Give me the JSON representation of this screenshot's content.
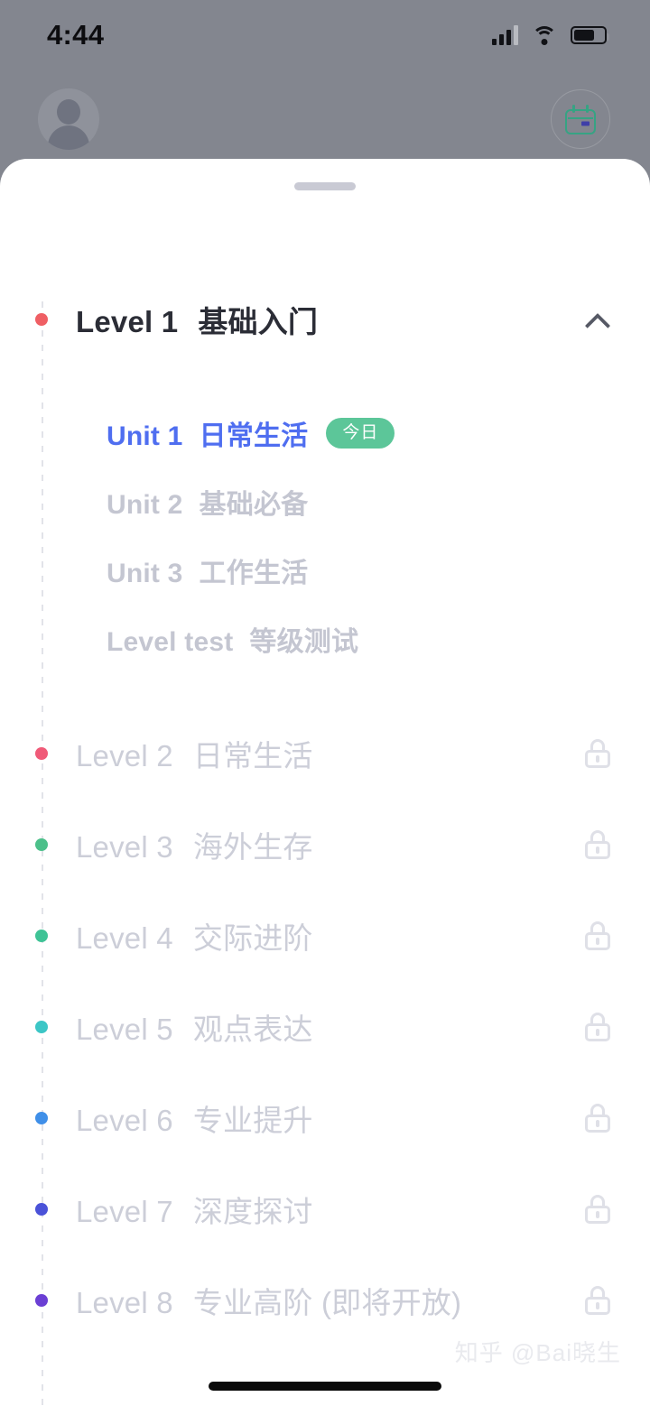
{
  "status_bar": {
    "time": "4:44",
    "signal_icon": "cellular-signal-icon",
    "wifi_icon": "wifi-icon",
    "battery_icon": "battery-icon",
    "battery_percent": 60
  },
  "backdrop_header": {
    "avatar_icon": "avatar-placeholder-icon",
    "calendar_icon": "calendar-icon",
    "calendar_accent": "#36a383"
  },
  "sheet": {
    "handle_icon": "drag-handle"
  },
  "course": {
    "expanded_level": {
      "name": "Level 1",
      "title": "基础入门",
      "dot_color": "#ef5f64",
      "collapse_icon": "chevron-up-icon",
      "units": [
        {
          "name": "Unit 1",
          "title": "日常生活",
          "badge": "今日",
          "active": true
        },
        {
          "name": "Unit 2",
          "title": "基础必备",
          "badge": "",
          "active": false
        },
        {
          "name": "Unit 3",
          "title": "工作生活",
          "badge": "",
          "active": false
        },
        {
          "name": "Level test",
          "title": "等级测试",
          "badge": "",
          "active": false
        }
      ]
    },
    "locked_levels": [
      {
        "name": "Level 2",
        "title": "日常生活",
        "dot_color": "#f05a78",
        "lock_icon": "lock-icon"
      },
      {
        "name": "Level 3",
        "title": "海外生存",
        "dot_color": "#4cc08a",
        "lock_icon": "lock-icon"
      },
      {
        "name": "Level 4",
        "title": "交际进阶",
        "dot_color": "#3fc396",
        "lock_icon": "lock-icon"
      },
      {
        "name": "Level 5",
        "title": "观点表达",
        "dot_color": "#3cc6c6",
        "lock_icon": "lock-icon"
      },
      {
        "name": "Level 6",
        "title": "专业提升",
        "dot_color": "#3f8fe8",
        "lock_icon": "lock-icon"
      },
      {
        "name": "Level 7",
        "title": "深度探讨",
        "dot_color": "#4a52d8",
        "lock_icon": "lock-icon"
      },
      {
        "name": "Level 8",
        "title": "专业高阶 (即将开放)",
        "dot_color": "#6b3fd4",
        "lock_icon": "lock-icon"
      }
    ]
  },
  "watermark": {
    "text": "知乎 @Bai晓生"
  },
  "home_indicator": {
    "icon": "home-indicator-bar"
  }
}
